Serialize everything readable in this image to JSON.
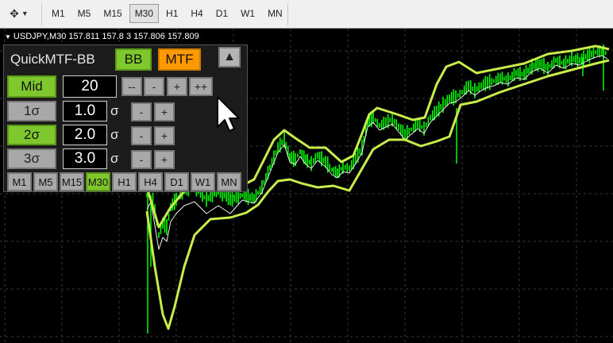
{
  "toolbar": {
    "tool_icon": "cursor-tool-icon",
    "timeframes": [
      "M1",
      "M5",
      "M15",
      "M30",
      "H1",
      "H4",
      "D1",
      "W1",
      "MN"
    ],
    "active_timeframe": "M30"
  },
  "chart": {
    "header": {
      "symbol": "USDJPY,M30",
      "prices": "157.811 157.8 3 157.806 157.809"
    },
    "colors": {
      "candles": "#00ff00",
      "bands": "#c8ec4a",
      "mid": "#f0f0f0",
      "grid": "#3a3a3a"
    }
  },
  "panel": {
    "title": "QuickMTF-BB",
    "bb_label": "BB",
    "mtf_label": "MTF",
    "collapse_icon": "triangle-up-icon",
    "mid_label": "Mid",
    "mid_value": "20",
    "step_buttons": [
      "--",
      "-",
      "+",
      "++"
    ],
    "bands": [
      {
        "label": "1σ",
        "value": "1.0",
        "unit": "σ",
        "active": false
      },
      {
        "label": "2σ",
        "value": "2.0",
        "unit": "σ",
        "active": true
      },
      {
        "label": "3σ",
        "value": "3.0",
        "unit": "σ",
        "active": false
      }
    ],
    "minus": "-",
    "plus": "+",
    "timeframes": [
      "M1",
      "M5",
      "M15",
      "M30",
      "H1",
      "H4",
      "D1",
      "W1",
      "MN"
    ],
    "active_timeframe": "M30"
  }
}
